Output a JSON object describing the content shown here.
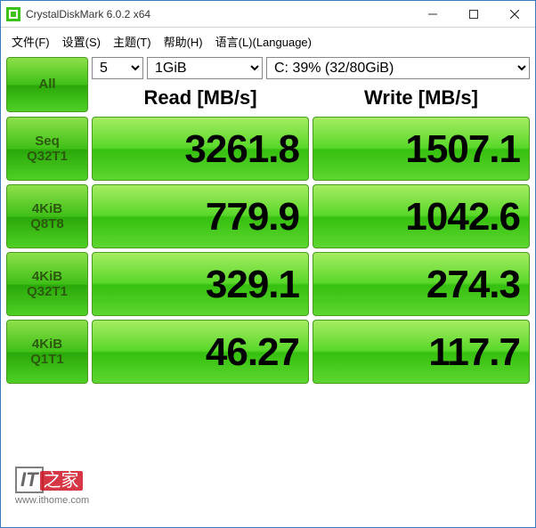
{
  "window": {
    "title": "CrystalDiskMark 6.0.2 x64"
  },
  "menu": {
    "file": "文件(F)",
    "settings": "设置(S)",
    "theme": "主题(T)",
    "help": "帮助(H)",
    "language": "语言(L)(Language)"
  },
  "controls": {
    "count": "5",
    "size": "1GiB",
    "drive": "C: 39% (32/80GiB)"
  },
  "headers": {
    "read": "Read [MB/s]",
    "write": "Write [MB/s]"
  },
  "buttons": {
    "all": "All",
    "r1a": "Seq",
    "r1b": "Q32T1",
    "r2a": "4KiB",
    "r2b": "Q8T8",
    "r3a": "4KiB",
    "r3b": "Q32T1",
    "r4a": "4KiB",
    "r4b": "Q1T1"
  },
  "results": {
    "seq_q32t1": {
      "read": "3261.8",
      "write": "1507.1"
    },
    "k4_q8t8": {
      "read": "779.9",
      "write": "1042.6"
    },
    "k4_q32t1": {
      "read": "329.1",
      "write": "274.3"
    },
    "k4_q1t1": {
      "read": "46.27",
      "write": "117.7"
    }
  },
  "chart_data": {
    "type": "table",
    "title": "CrystalDiskMark 6.0.2 x64",
    "columns": [
      "Test",
      "Read [MB/s]",
      "Write [MB/s]"
    ],
    "rows": [
      [
        "Seq Q32T1",
        3261.8,
        1507.1
      ],
      [
        "4KiB Q8T8",
        779.9,
        1042.6
      ],
      [
        "4KiB Q32T1",
        329.1,
        274.3
      ],
      [
        "4KiB Q1T1",
        46.27,
        117.7
      ]
    ],
    "drive": "C: 39% (32/80GiB)",
    "test_size": "1GiB",
    "test_count": 5
  },
  "watermark": {
    "brand1": "IT",
    "brand2": "之家",
    "url": "www.ithome.com"
  }
}
